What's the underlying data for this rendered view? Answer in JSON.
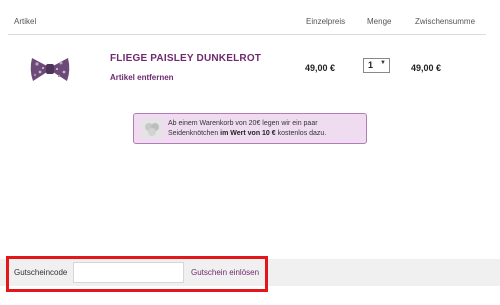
{
  "table_header": {
    "article": "Artikel",
    "unit_price": "Einzelpreis",
    "quantity": "Menge",
    "subtotal": "Zwischensumme"
  },
  "item": {
    "name": "FLIEGE PAISLEY DUNKELROT",
    "remove_label": "Artikel entfernen",
    "unit_price": "49,00 €",
    "quantity": "1",
    "subtotal": "49,00 €",
    "thumbnail_icon": "bow-tie-image"
  },
  "promo": {
    "icon": "gift-icon",
    "text_part1": "Ab einem Warenkorb von 20€ legen wir ein paar Seidenknötchen ",
    "text_bold": "im Wert von 10 €",
    "text_part2": " kostenlos dazu."
  },
  "coupon": {
    "label": "Gutscheincode",
    "value": "",
    "button_label": "Gutschein einlösen"
  },
  "colors": {
    "accent": "#6e2a6e",
    "promo_bg": "#f0dcf1",
    "promo_border": "#b57ab8",
    "highlight": "#e3161a"
  }
}
